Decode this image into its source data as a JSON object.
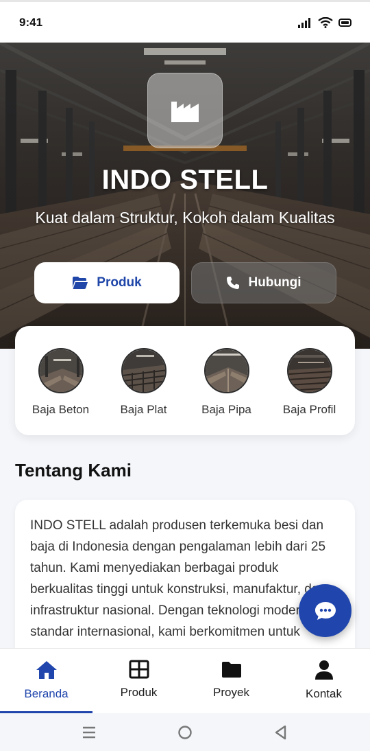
{
  "status_bar": {
    "time": "9:41"
  },
  "hero": {
    "brand": "INDO STELL",
    "tagline": "Kuat dalam Struktur, Kokoh dalam Kualitas",
    "logo_icon": "factory-icon",
    "buttons": [
      {
        "label": "Produk",
        "icon": "folder-open-icon"
      },
      {
        "label": "Hubungi",
        "icon": "phone-icon"
      }
    ]
  },
  "categories": [
    {
      "label": "Baja Beton"
    },
    {
      "label": "Baja Plat"
    },
    {
      "label": "Baja Pipa"
    },
    {
      "label": "Baja Profil"
    }
  ],
  "about": {
    "title": "Tentang Kami",
    "text": "INDO STELL adalah produsen terkemuka besi dan baja di Indonesia dengan pengalaman lebih dari 25 tahun. Kami menyediakan berbagai produk berkualitas tinggi untuk konstruksi, manufaktur, dan infrastruktur nasional. Dengan teknologi modern dan standar internasional, kami berkomitmen untuk"
  },
  "bottom_nav": {
    "items": [
      {
        "label": "Beranda",
        "icon": "home-icon",
        "active": true
      },
      {
        "label": "Produk",
        "icon": "grid-icon",
        "active": false
      },
      {
        "label": "Proyek",
        "icon": "folder-icon",
        "active": false
      },
      {
        "label": "Kontak",
        "icon": "user-icon",
        "active": false
      }
    ]
  },
  "colors": {
    "primary": "#2046ad",
    "background": "#f4f6fa",
    "card": "#ffffff"
  }
}
